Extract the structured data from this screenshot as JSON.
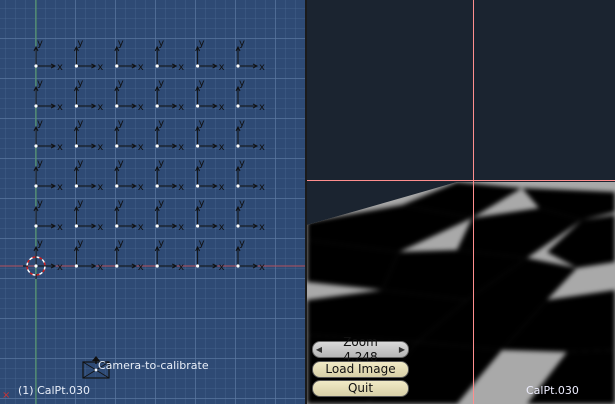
{
  "viewport3d": {
    "object_name": "(1) CalPt.030",
    "camera_label": "Camera-to-calibrate",
    "axis_label_x": "x",
    "axis_label_y": "y",
    "colors": {
      "background": "#2e4a74",
      "axis_line": "#111111",
      "point": "#ffffff",
      "x_axis_red": "#b5505c",
      "y_axis_green": "#55a060"
    },
    "icons": [
      "empty-axis-icon",
      "cursor-3d-icon",
      "camera-icon"
    ],
    "grid": {
      "rows": 6,
      "columns": 6
    }
  },
  "image_editor": {
    "zoom_label": "Zoom 4.248",
    "load_image_label": "Load Image",
    "quit_label": "Quit",
    "object_name": "CalPt.030",
    "colors": {
      "background": "#1b2430",
      "crosshair": "#ff8e8e",
      "button": "#e8e1bd"
    }
  }
}
